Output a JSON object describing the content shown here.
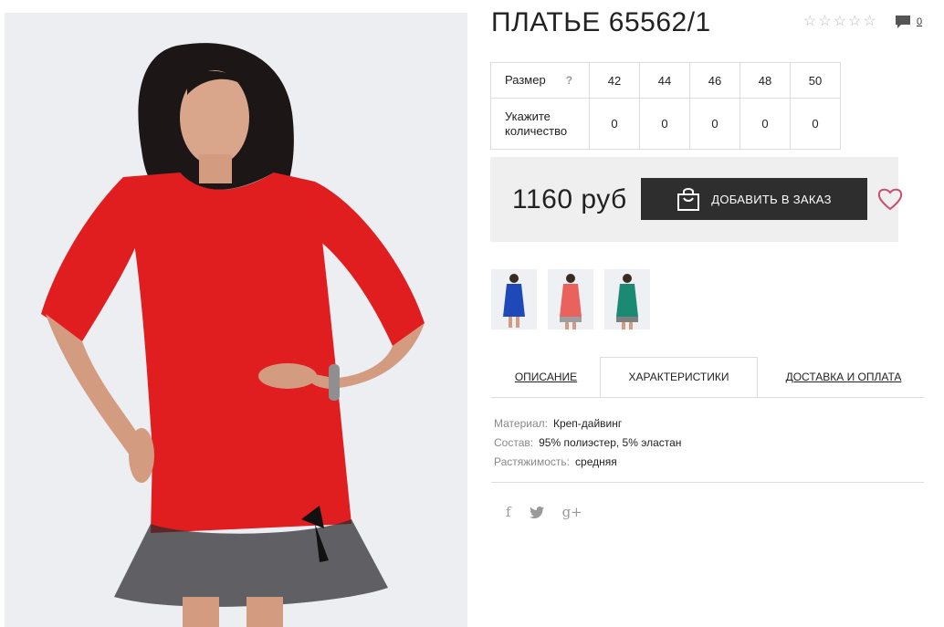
{
  "product": {
    "title": "ПЛАТЬЕ 65562/1",
    "comment_count": "0",
    "rating_stars": 0,
    "price": "1160 руб"
  },
  "sizes": {
    "size_label": "Размер",
    "help_mark": "?",
    "qty_label": "Укажите количество",
    "values": [
      "42",
      "44",
      "46",
      "48",
      "50"
    ],
    "quantities": [
      "0",
      "0",
      "0",
      "0",
      "0"
    ]
  },
  "buy": {
    "add_label": "ДОБАВИТЬ В ЗАКАЗ"
  },
  "thumbnails": [
    {
      "color": "#1f49b8"
    },
    {
      "color": "#e9625e"
    },
    {
      "color": "#1b8a72"
    }
  ],
  "main_dress_color": "#e01d1f",
  "tabs": {
    "description": "ОПИСАНИЕ",
    "characteristics": "ХАРАКТЕРИСТИКИ",
    "delivery": "ДОСТАВКА И ОПЛАТА",
    "active": "characteristics"
  },
  "specs": [
    {
      "key": "Материал:",
      "value": "Креп-дайвинг"
    },
    {
      "key": "Состав:",
      "value": "95% полиэстер, 5% эластан"
    },
    {
      "key": "Растяжимость:",
      "value": "средняя"
    }
  ],
  "social": {
    "facebook": "f",
    "twitter": "twitter-icon",
    "googleplus": "g+"
  }
}
